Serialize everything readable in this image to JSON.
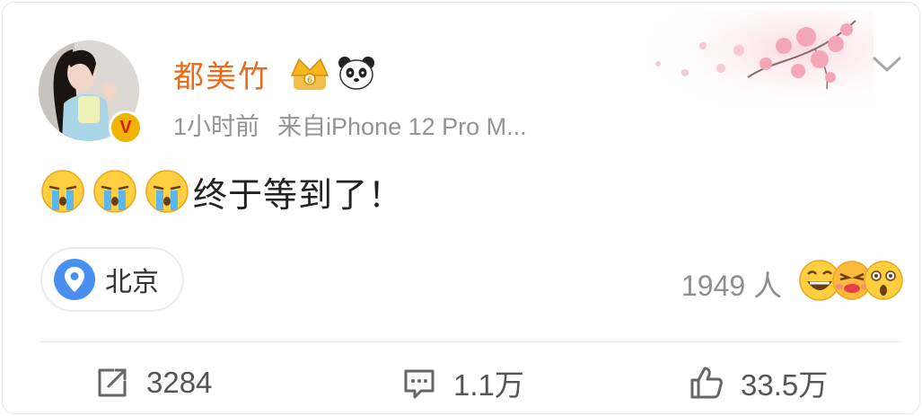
{
  "post": {
    "username": "都美竹",
    "time": "1小时前",
    "source": "来自iPhone 12 Pro M...",
    "content": "终于等到了！",
    "location": "北京",
    "reaction_count": "1949 人"
  },
  "actions": {
    "repost": "3284",
    "comment": "1.1万",
    "like": "33.5万"
  },
  "colors": {
    "username": "#e86b19",
    "meta": "#939393",
    "location_pin": "#4a8ff0",
    "vip_badge": "#f0b400"
  },
  "icons": [
    "crown-icon",
    "panda-icon",
    "chevron-down-icon",
    "crying-emoji-icon",
    "location-pin-icon",
    "reaction-emoji-icon",
    "repost-icon",
    "comment-icon",
    "like-icon"
  ]
}
